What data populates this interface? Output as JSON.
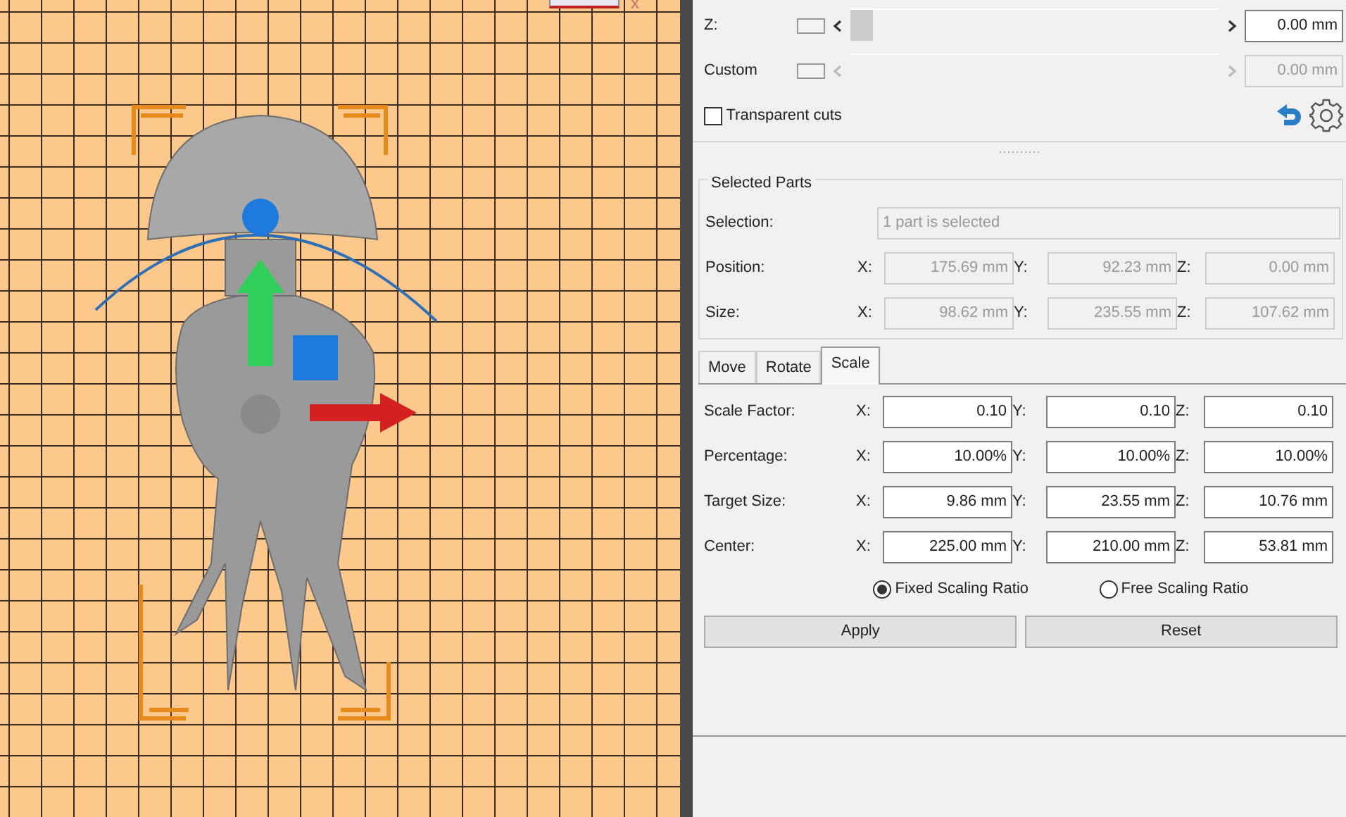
{
  "viewport": {
    "axis_label": "x"
  },
  "clipping": {
    "rows": [
      {
        "label": "Z:",
        "value": "0.00 mm",
        "disabled": false,
        "level": 0
      },
      {
        "label": "Custom",
        "value": "0.00 mm",
        "disabled": true
      }
    ],
    "transparent_cuts": {
      "label": "Transparent cuts",
      "checked": false
    }
  },
  "selected_parts": {
    "title": "Selected Parts",
    "selection": {
      "label": "Selection:",
      "value": "1 part is selected"
    },
    "rows": [
      {
        "label": "Position:",
        "fields": [
          {
            "axis": "X:",
            "value": "175.69 mm"
          },
          {
            "axis": "Y:",
            "value": "92.23 mm"
          },
          {
            "axis": "Z:",
            "value": "0.00 mm"
          }
        ]
      },
      {
        "label": "Size:",
        "fields": [
          {
            "axis": "X:",
            "value": "98.62 mm"
          },
          {
            "axis": "Y:",
            "value": "235.55 mm"
          },
          {
            "axis": "Z:",
            "value": "107.62 mm"
          }
        ]
      }
    ]
  },
  "tabs": [
    {
      "label": "Move",
      "selected": false
    },
    {
      "label": "Rotate",
      "selected": false
    },
    {
      "label": "Scale",
      "selected": true
    }
  ],
  "scale": {
    "rows": [
      {
        "label": "Scale Factor:",
        "fields": [
          {
            "axis": "X:",
            "value": "0.10"
          },
          {
            "axis": "Y:",
            "value": "0.10"
          },
          {
            "axis": "Z:",
            "value": "0.10"
          }
        ]
      },
      {
        "label": "Percentage:",
        "fields": [
          {
            "axis": "X:",
            "value": "10.00%"
          },
          {
            "axis": "Y:",
            "value": "10.00%"
          },
          {
            "axis": "Z:",
            "value": "10.00%"
          }
        ]
      },
      {
        "label": "Target Size:",
        "fields": [
          {
            "axis": "X:",
            "value": "9.86 mm"
          },
          {
            "axis": "Y:",
            "value": "23.55 mm"
          },
          {
            "axis": "Z:",
            "value": "10.76 mm"
          }
        ]
      },
      {
        "label": "Center:",
        "fields": [
          {
            "axis": "X:",
            "value": "225.00 mm"
          },
          {
            "axis": "Y:",
            "value": "210.00 mm"
          },
          {
            "axis": "Z:",
            "value": "53.81 mm"
          }
        ]
      }
    ],
    "ratio_options": [
      {
        "label": "Fixed Scaling Ratio",
        "selected": true
      },
      {
        "label": "Free Scaling Ratio",
        "selected": false
      }
    ],
    "buttons": [
      "Apply",
      "Reset"
    ]
  }
}
